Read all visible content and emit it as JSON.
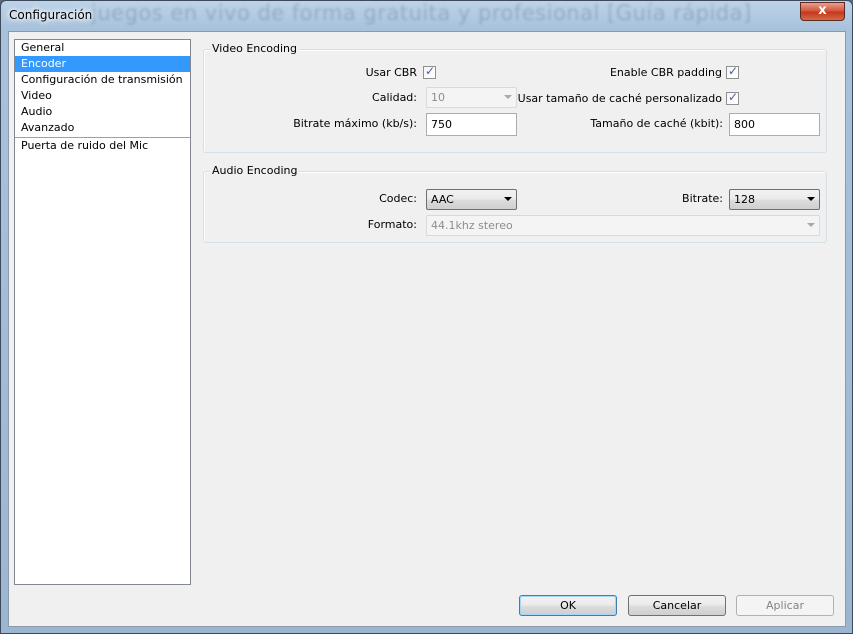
{
  "window": {
    "title": "Configuración",
    "background_title": "juegos en vivo de forma gratuita y profesional [Guía rápida]",
    "close_label": "x"
  },
  "nav": {
    "items": [
      {
        "label": "General",
        "selected": false
      },
      {
        "label": "Encoder",
        "selected": true
      },
      {
        "label": "Configuración de transmisión",
        "selected": false
      },
      {
        "label": "Video",
        "selected": false
      },
      {
        "label": "Audio",
        "selected": false
      },
      {
        "label": "Avanzado",
        "selected": false
      }
    ],
    "extra_item": "Puerta de ruido del Mic"
  },
  "video_encoding": {
    "title": "Video Encoding",
    "use_cbr_label": "Usar CBR",
    "use_cbr_checked": true,
    "quality_label": "Calidad:",
    "quality_value": "10",
    "max_bitrate_label": "Bitrate máximo (kb/s):",
    "max_bitrate_value": "750",
    "cbr_padding_label": "Enable CBR padding",
    "cbr_padding_checked": true,
    "custom_cache_label": "Usar tamaño de caché personalizado",
    "custom_cache_checked": true,
    "cache_size_label": "Tamaño de caché (kbit):",
    "cache_size_value": "800"
  },
  "audio_encoding": {
    "title": "Audio Encoding",
    "codec_label": "Codec:",
    "codec_value": "AAC",
    "bitrate_label": "Bitrate:",
    "bitrate_value": "128",
    "format_label": "Formato:",
    "format_value": "44.1khz stereo"
  },
  "buttons": {
    "ok": "OK",
    "cancel": "Cancelar",
    "apply": "Aplicar"
  },
  "colors": {
    "selection": "#3399ff",
    "close_button": "#c3391c"
  }
}
